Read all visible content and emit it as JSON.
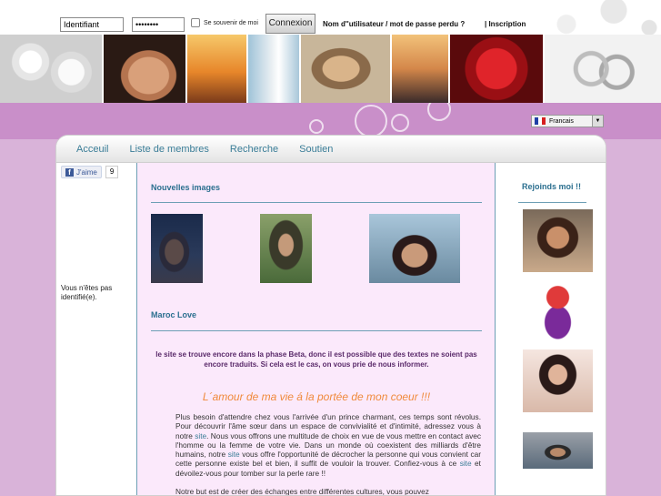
{
  "login": {
    "username_value": "Identifiant",
    "password_value": "••••••••",
    "remember_label": "Se souvenir de moi",
    "connect_label": "Connexion",
    "lost_label": "Nom d''utilisateur / mot de passe perdu ?",
    "register_label": "| Inscription"
  },
  "language": {
    "selected": "Francais"
  },
  "nav": {
    "items": [
      "Acceuil",
      "Liste de membres",
      "Recherche",
      "Soutien"
    ]
  },
  "sidebar_left": {
    "like_label": "J'aime",
    "like_count": "9",
    "status_text": "Vous n'êtes pas identifié(e)."
  },
  "main": {
    "new_images_title": "Nouvelles images",
    "section_title": "Maroc Love",
    "beta_notice": "le site se trouve encore dans la phase Beta, donc il est possible que des textes ne soient pas encore traduits. Si cela est le cas, on vous prie de nous informer.",
    "headline": "L´amour de ma vie á la portée de mon coeur !!!",
    "paragraph_1": "Plus besoin d'attendre chez vous  l'arrivée d'un prince charmant, ces temps sont révolus. Pour  découvrir l'âme sœur dans un espace de convivialité et d'intimité, adressez vous à notre ",
    "link_site_1": "site",
    "paragraph_2": ". Nous vous offrons une multitude de choix  en vue de vous mettre en contact avec l'homme ou  la femme de votre vie. Dans un monde où coexistent des milliards d'être humains, notre ",
    "link_site_2": "site",
    "paragraph_3": " vous offre l'opportunité de  décrocher la personne qui vous convient car cette personne existe bel et bien, il suffit de vouloir la trouver. Confiez-vous à ce ",
    "link_site_3": "site",
    "paragraph_4": " et dévoilez-vous pour tomber sur la perle rare !!",
    "paragraph_5": "Notre but est de créer des échanges  entre différentes cultures, vous pouvez"
  },
  "sidebar_right": {
    "title": "Rejoinds moi !!"
  },
  "colors": {
    "page_bg": "#d9b3d9",
    "link": "#3a7d97",
    "accent_orange": "#f08a3c",
    "content_bg": "#fbe9fb"
  }
}
